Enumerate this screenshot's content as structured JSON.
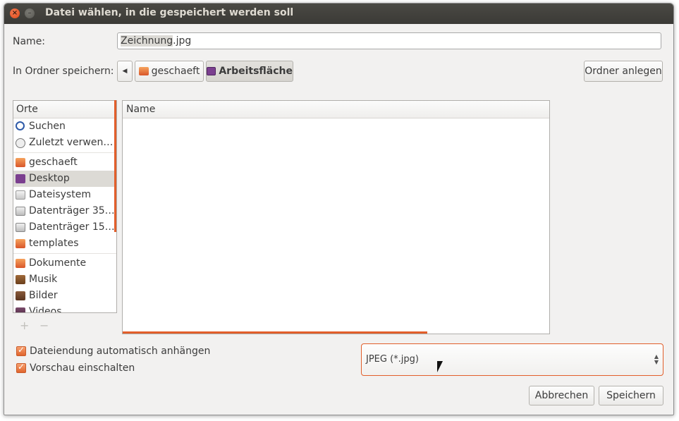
{
  "window": {
    "title": "Datei wählen, in die gespeichert werden soll"
  },
  "name_row": {
    "label": "Name:",
    "value_selected": "Zeichnung",
    "value_ext": ".jpg"
  },
  "folder_row": {
    "label": "In Ordner speichern:",
    "path": [
      "geschaeft",
      "Arbeitsfläche"
    ],
    "create_button": "Ordner anlegen"
  },
  "places": {
    "header": "Orte",
    "groups": [
      [
        {
          "label": "Suchen",
          "icon": "search-icon"
        },
        {
          "label": "Zuletzt verwen…",
          "icon": "clock-icon"
        }
      ],
      [
        {
          "label": "geschaeft",
          "icon": "folder-icon"
        },
        {
          "label": "Desktop",
          "icon": "desktop-icon",
          "selected": true
        },
        {
          "label": "Dateisystem",
          "icon": "drive-icon"
        },
        {
          "label": "Datenträger 35…",
          "icon": "usb-drive-icon"
        },
        {
          "label": "Datenträger 15…",
          "icon": "usb-drive-icon"
        },
        {
          "label": "templates",
          "icon": "folder-icon"
        }
      ],
      [
        {
          "label": "Dokumente",
          "icon": "documents-icon"
        },
        {
          "label": "Musik",
          "icon": "music-icon"
        },
        {
          "label": "Bilder",
          "icon": "pictures-icon"
        },
        {
          "label": "Videos",
          "icon": "videos-icon"
        }
      ]
    ],
    "add_label": "+",
    "remove_label": "−"
  },
  "files": {
    "header": "Name"
  },
  "options": {
    "append_extension": "Dateiendung automatisch anhängen",
    "enable_preview": "Vorschau einschalten"
  },
  "filter": {
    "selected": "JPEG (*.jpg)"
  },
  "buttons": {
    "cancel": "Abbrechen",
    "save": "Speichern"
  },
  "colors": {
    "accent": "#e25e2a",
    "titlebar": "#3b3a36",
    "selection": "#dcdad5"
  }
}
